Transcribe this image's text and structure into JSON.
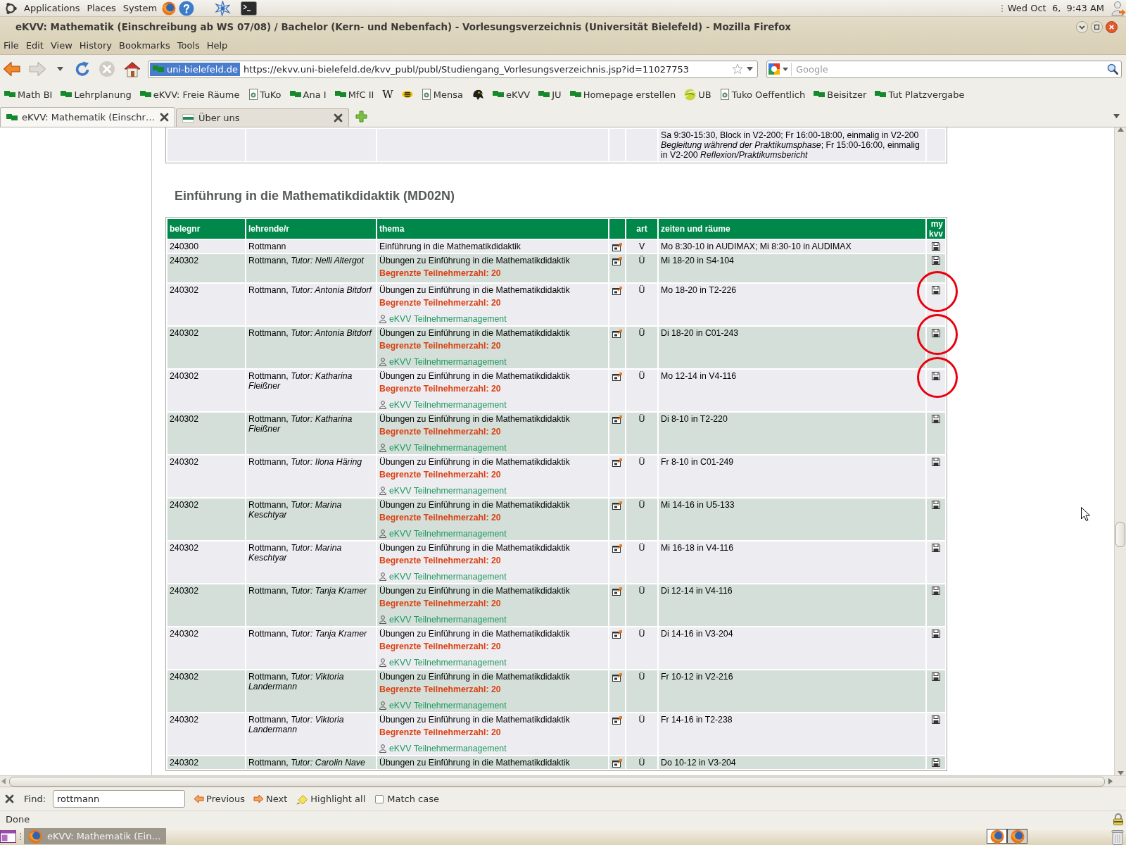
{
  "top_panel": {
    "menus": [
      "Applications",
      "Places",
      "System"
    ],
    "clock": "Wed Oct  6,  9:43 AM"
  },
  "window": {
    "title": "eKVV: Mathematik (Einschreibung ab WS 07/08) / Bachelor (Kern- und Nebenfach) - Vorlesungsverzeichnis (Universität Bielefeld) - Mozilla Firefox"
  },
  "menu_bar": [
    "File",
    "Edit",
    "View",
    "History",
    "Bookmarks",
    "Tools",
    "Help"
  ],
  "navigation": {
    "buttons": [
      {
        "kind": "back",
        "disabled": false
      },
      {
        "kind": "forward",
        "disabled": true
      },
      {
        "kind": "history",
        "disabled": false
      },
      {
        "kind": "reload",
        "disabled": false
      },
      {
        "kind": "stop",
        "disabled": true
      },
      {
        "kind": "home",
        "disabled": false
      }
    ],
    "site_identity": "uni-bielefeld.de",
    "url": "https://ekvv.uni-bielefeld.de/kvv_publ/publ/Studiengang_Vorlesungsverzeichnis.jsp?id=11027753",
    "search": {
      "placeholder": "Google"
    }
  },
  "bookmarks": [
    {
      "kind": "flag",
      "label": "Math BI"
    },
    {
      "kind": "flag",
      "label": "Lehrplanung"
    },
    {
      "kind": "flag",
      "label": "eKVV: Freie Räume"
    },
    {
      "kind": "page",
      "label": "TuKo"
    },
    {
      "kind": "flag",
      "label": "Ana I"
    },
    {
      "kind": "flag",
      "label": "MfC II"
    },
    {
      "kind": "letter",
      "label": "W"
    },
    {
      "kind": "emblem"
    },
    {
      "kind": "page",
      "label": "Mensa"
    },
    {
      "kind": "creature"
    },
    {
      "kind": "flag",
      "label": "eKVV"
    },
    {
      "kind": "flag",
      "label": "JU"
    },
    {
      "kind": "flag",
      "label": "Homepage erstellen"
    },
    {
      "kind": "swirl",
      "label": "UB"
    },
    {
      "kind": "page",
      "label": "Tuko Oeffentlich"
    },
    {
      "kind": "flag",
      "label": "Beisitzer"
    },
    {
      "kind": "flag",
      "label": "Tut Platzvergabe"
    }
  ],
  "tabs": [
    {
      "label": "eKVV: Mathematik (Einschr…",
      "kind": "flag",
      "selected": true
    },
    {
      "label": "Über uns",
      "kind": "banner",
      "selected": false
    }
  ],
  "page": {
    "previous_table": {
      "rows": [
        {
          "times": "Sa 9:30-15:30, Block in V2-200; Fr 16:00-18:00, einmalig in V2-200 *Begleitung während der Praktikumsphase*; Fr 15:00-16:00, einmalig in V2-200 *Reflexion/Praktikumsbericht*"
        }
      ]
    },
    "section": {
      "heading": "Einführung in die Mathematikdidaktik (MD02N)",
      "columns": [
        {
          "kind": "text",
          "label": "belegnr"
        },
        {
          "kind": "text",
          "label": "lehrende/r"
        },
        {
          "kind": "text",
          "label": "thema"
        },
        {
          "kind": "blank"
        },
        {
          "kind": "centered",
          "label": "art"
        },
        {
          "kind": "text",
          "label": "zeiten und räume"
        },
        {
          "kind": "right",
          "label": "my kvv"
        }
      ],
      "rows": [
        {
          "number": "240300",
          "lecturer": "Rottmann",
          "topic": "Einführung in die Mathematikdidaktik",
          "type": "V",
          "times": "Mo 8:30-10 in AUDIMAX; Mi 8:30-10 in AUDIMAX",
          "circled": false
        },
        {
          "number": "240302",
          "lecturer": "Rottmann, *Tutor: Nelli Altergot*",
          "topic": "Übungen zu Einführung in die Mathematikdidaktik",
          "limit": "Begrenzte Teilnehmerzahl: 20",
          "type": "Ü",
          "times": "Mi 18-20 in S4-104",
          "circled": false
        },
        {
          "number": "240302",
          "lecturer": "Rottmann, *Tutor: Antonia Bitdorf*",
          "topic": "Übungen zu Einführung in die Mathematikdidaktik",
          "limit": "Begrenzte Teilnehmerzahl: 20",
          "management_link": "eKVV Teilnehmermanagement",
          "type": "Ü",
          "times": "Mo 18-20 in T2-226",
          "circled": true
        },
        {
          "number": "240302",
          "lecturer": "Rottmann, *Tutor: Antonia Bitdorf*",
          "topic": "Übungen zu Einführung in die Mathematikdidaktik",
          "limit": "Begrenzte Teilnehmerzahl: 20",
          "management_link": "eKVV Teilnehmermanagement",
          "type": "Ü",
          "times": "Di 18-20 in C01-243",
          "circled": true
        },
        {
          "number": "240302",
          "lecturer": "Rottmann, *Tutor: Katharina Fleißner*",
          "topic": "Übungen zu Einführung in die Mathematikdidaktik",
          "limit": "Begrenzte Teilnehmerzahl: 20",
          "management_link": "eKVV Teilnehmermanagement",
          "type": "Ü",
          "times": "Mo 12-14 in V4-116",
          "circled": true
        },
        {
          "number": "240302",
          "lecturer": "Rottmann, *Tutor: Katharina Fleißner*",
          "topic": "Übungen zu Einführung in die Mathematikdidaktik",
          "limit": "Begrenzte Teilnehmerzahl: 20",
          "management_link": "eKVV Teilnehmermanagement",
          "type": "Ü",
          "times": "Di 8-10 in T2-220",
          "circled": false
        },
        {
          "number": "240302",
          "lecturer": "Rottmann, *Tutor: Ilona Häring*",
          "topic": "Übungen zu Einführung in die Mathematikdidaktik",
          "limit": "Begrenzte Teilnehmerzahl: 20",
          "management_link": "eKVV Teilnehmermanagement",
          "type": "Ü",
          "times": "Fr 8-10 in C01-249",
          "circled": false
        },
        {
          "number": "240302",
          "lecturer": "Rottmann, *Tutor: Marina Keschtyar*",
          "topic": "Übungen zu Einführung in die Mathematikdidaktik",
          "limit": "Begrenzte Teilnehmerzahl: 20",
          "management_link": "eKVV Teilnehmermanagement",
          "type": "Ü",
          "times": "Mi 14-16 in U5-133",
          "circled": false
        },
        {
          "number": "240302",
          "lecturer": "Rottmann, *Tutor: Marina Keschtyar*",
          "topic": "Übungen zu Einführung in die Mathematikdidaktik",
          "limit": "Begrenzte Teilnehmerzahl: 20",
          "management_link": "eKVV Teilnehmermanagement",
          "type": "Ü",
          "times": "Mi 16-18 in V4-116",
          "circled": false
        },
        {
          "number": "240302",
          "lecturer": "Rottmann, *Tutor: Tanja Kramer*",
          "topic": "Übungen zu Einführung in die Mathematikdidaktik",
          "limit": "Begrenzte Teilnehmerzahl: 20",
          "management_link": "eKVV Teilnehmermanagement",
          "type": "Ü",
          "times": "Di 12-14 in V4-116",
          "circled": false
        },
        {
          "number": "240302",
          "lecturer": "Rottmann, *Tutor: Tanja Kramer*",
          "topic": "Übungen zu Einführung in die Mathematikdidaktik",
          "limit": "Begrenzte Teilnehmerzahl: 20",
          "management_link": "eKVV Teilnehmermanagement",
          "type": "Ü",
          "times": "Di 14-16 in V3-204",
          "circled": false
        },
        {
          "number": "240302",
          "lecturer": "Rottmann, *Tutor: Viktoria Landermann*",
          "topic": "Übungen zu Einführung in die Mathematikdidaktik",
          "limit": "Begrenzte Teilnehmerzahl: 20",
          "management_link": "eKVV Teilnehmermanagement",
          "type": "Ü",
          "times": "Fr 10-12 in V2-216",
          "circled": false
        },
        {
          "number": "240302",
          "lecturer": "Rottmann, *Tutor: Viktoria Landermann*",
          "topic": "Übungen zu Einführung in die Mathematikdidaktik",
          "limit": "Begrenzte Teilnehmerzahl: 20",
          "management_link": "eKVV Teilnehmermanagement",
          "type": "Ü",
          "times": "Fr 14-16 in T2-238",
          "circled": false
        },
        {
          "number": "240302",
          "lecturer": "Rottmann, *Tutor: Carolin Nave*",
          "topic": "Übungen zu Einführung in die Mathematikdidaktik",
          "type": "Ü",
          "times": "Do 10-12 in V3-204",
          "circled": false
        }
      ]
    }
  },
  "find_bar": {
    "label": "Find:",
    "value": "rottmann",
    "buttons": [
      {
        "kind": "previous",
        "label": "Previous"
      },
      {
        "kind": "next",
        "label": "Next"
      },
      {
        "kind": "highlight",
        "label": "Highlight all"
      }
    ],
    "match_case": {
      "label": "Match case",
      "checked": false
    }
  },
  "status_bar": {
    "text": "Done"
  },
  "bottom_panel": {
    "windows": [
      {
        "label": "eKVV: Mathematik (Ein…"
      }
    ],
    "workspaces": [
      {
        "selected": true
      },
      {
        "selected": false
      }
    ]
  }
}
